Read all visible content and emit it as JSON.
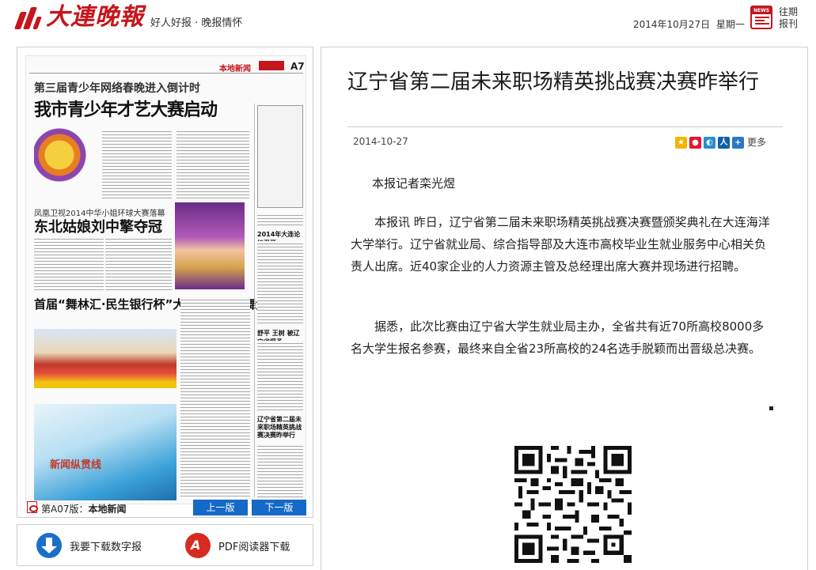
{
  "header": {
    "logo_text": "大連晚報",
    "slogan": "好人好报 · 晚报情怀",
    "date": "2014年10月27日",
    "weekday": "星期一",
    "news_icon_label": "NEWS",
    "past_issues": "往期报刊"
  },
  "newspaper_page": {
    "section": "本地新闻",
    "page_number": "A7",
    "subheadline_1": "第三届青少年网络春晚进入倒计时",
    "headline_1": "我市青少年才艺大赛启动",
    "subheadline_2": "凤凰卫视2014中华小姐环球大赛落幕",
    "headline_2": "东北姑娘刘中擎夺冠",
    "headline_3": "首届“舞林汇·民生银行杯”大连社区广场舞大赛落幕",
    "ad_text": "新闻纵贯线",
    "side_head_1": "2014年大连论坛召开",
    "side_head_2": "舒平 王树 被辽宁省授予",
    "side_head_3": "辽宁省第二届未来职场精英挑战赛决赛昨举行"
  },
  "page_bar": {
    "page_prefix": "第A07版：",
    "page_name": "本地新闻",
    "prev_label": "上一版",
    "next_label": "下一版"
  },
  "downloads": {
    "digital_label": "我要下载数字报",
    "pdf_label": "PDF阅读器下载"
  },
  "article": {
    "title": "辽宁省第二届未来职场精英挑战赛决赛昨举行",
    "date": "2014-10-27",
    "share_more": "更多",
    "reporter": "本报记者栾光煜",
    "paragraphs": [
      "本报讯 昨日，辽宁省第二届未来职场精英挑战赛决赛暨颁奖典礼在大连海洋大学举行。辽宁省就业局、综合指导部及大连市高校毕业生就业服务中心相关负责人出席。近40家企业的人力资源主管及总经理出席大赛并现场进行招聘。",
      "据悉，此次比赛由辽宁省大学生就业局主办，全省共有近70所高校8000多名大学生报名参赛，最终来自全省23所高校的24名选手脱颖而出晋级总决赛。"
    ]
  },
  "colors": {
    "brand_red": "#c4161c",
    "button_blue": "#1569c7",
    "download_blue": "#1a6fc9",
    "pdf_red": "#d62b20"
  },
  "icons": {
    "share": [
      "qzone-icon",
      "weibo-icon",
      "tencent-icon",
      "renren-icon",
      "plus-icon"
    ],
    "download": "download-arrow-icon",
    "pdf": "pdf-icon"
  }
}
